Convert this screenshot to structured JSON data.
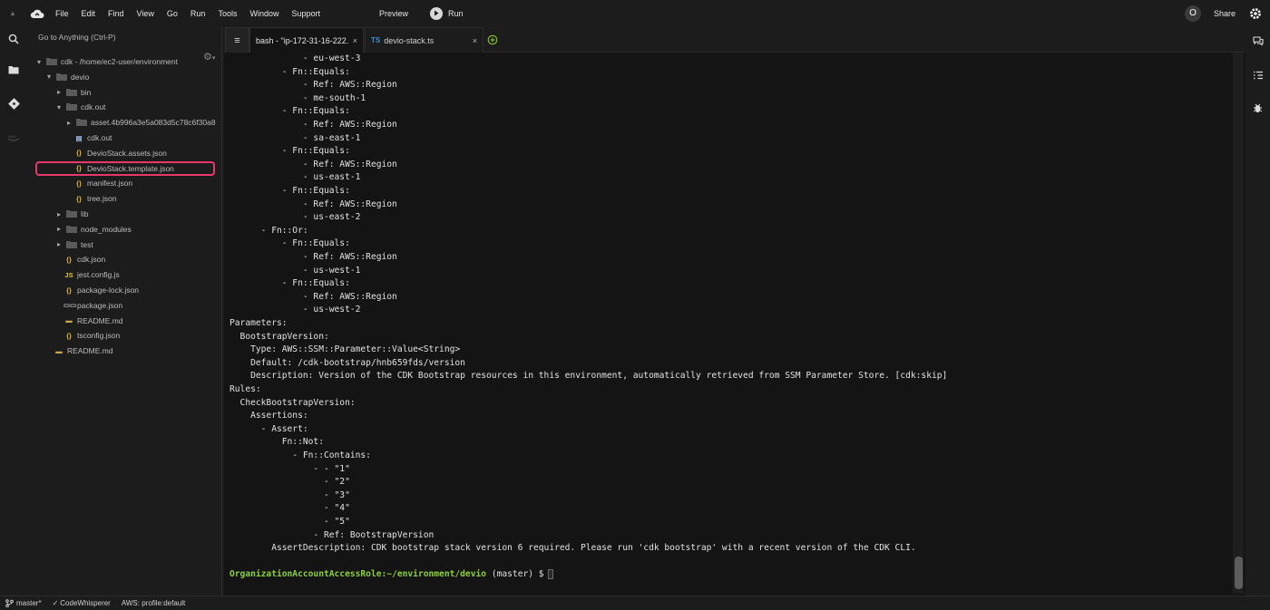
{
  "menubar": {
    "items": [
      "File",
      "Edit",
      "Find",
      "View",
      "Go",
      "Run",
      "Tools",
      "Window",
      "Support"
    ],
    "preview": "Preview",
    "run": "Run",
    "avatar_initial": "O",
    "share": "Share"
  },
  "sidebar": {
    "goto_placeholder": "Go to Anything (Ctrl-P)",
    "tree": [
      {
        "label": "cdk - /home/ec2-user/environment",
        "type": "folder",
        "expanded": true,
        "depth": 0
      },
      {
        "label": "devio",
        "type": "folder",
        "expanded": true,
        "depth": 1
      },
      {
        "label": "bin",
        "type": "folder",
        "expanded": false,
        "depth": 2
      },
      {
        "label": "cdk.out",
        "type": "folder",
        "expanded": true,
        "depth": 2
      },
      {
        "label": "asset.4b996a3e5a083d5c78c6f30a8",
        "type": "folder",
        "expanded": false,
        "depth": 3
      },
      {
        "label": "cdk.out",
        "type": "file-doc",
        "depth": 3
      },
      {
        "label": "DevioStack.assets.json",
        "type": "file-json",
        "depth": 3
      },
      {
        "label": "DevioStack.template.json",
        "type": "file-json",
        "depth": 3,
        "selected": true
      },
      {
        "label": "manifest.json",
        "type": "file-json",
        "depth": 3
      },
      {
        "label": "tree.json",
        "type": "file-json",
        "depth": 3
      },
      {
        "label": "lib",
        "type": "folder",
        "expanded": false,
        "depth": 2
      },
      {
        "label": "node_modules",
        "type": "folder",
        "expanded": false,
        "depth": 2
      },
      {
        "label": "test",
        "type": "folder",
        "expanded": false,
        "depth": 2
      },
      {
        "label": "cdk.json",
        "type": "file-json",
        "depth": 2
      },
      {
        "label": "jest.config.js",
        "type": "file-js",
        "depth": 2
      },
      {
        "label": "package-lock.json",
        "type": "file-json",
        "depth": 2
      },
      {
        "label": "package.json",
        "type": "file-npm",
        "depth": 2
      },
      {
        "label": "README.md",
        "type": "file-md",
        "depth": 2
      },
      {
        "label": "tsconfig.json",
        "type": "file-json",
        "depth": 2
      },
      {
        "label": "README.md",
        "type": "file-md",
        "depth": 1
      }
    ]
  },
  "tabs": [
    {
      "label": "bash - \"ip-172-31-16-222.",
      "close": "×",
      "active": true
    },
    {
      "label": "devio-stack.ts",
      "badge": "TS",
      "close": "×",
      "active": false
    }
  ],
  "terminal": {
    "lines": [
      "              - eu-west-3",
      "          - Fn::Equals:",
      "              - Ref: AWS::Region",
      "              - me-south-1",
      "          - Fn::Equals:",
      "              - Ref: AWS::Region",
      "              - sa-east-1",
      "          - Fn::Equals:",
      "              - Ref: AWS::Region",
      "              - us-east-1",
      "          - Fn::Equals:",
      "              - Ref: AWS::Region",
      "              - us-east-2",
      "      - Fn::Or:",
      "          - Fn::Equals:",
      "              - Ref: AWS::Region",
      "              - us-west-1",
      "          - Fn::Equals:",
      "              - Ref: AWS::Region",
      "              - us-west-2",
      "Parameters:",
      "  BootstrapVersion:",
      "    Type: AWS::SSM::Parameter::Value<String>",
      "    Default: /cdk-bootstrap/hnb659fds/version",
      "    Description: Version of the CDK Bootstrap resources in this environment, automatically retrieved from SSM Parameter Store. [cdk:skip]",
      "Rules:",
      "  CheckBootstrapVersion:",
      "    Assertions:",
      "      - Assert:",
      "          Fn::Not:",
      "            - Fn::Contains:",
      "                - - \"1\"",
      "                  - \"2\"",
      "                  - \"3\"",
      "                  - \"4\"",
      "                  - \"5\"",
      "                - Ref: BootstrapVersion",
      "        AssertDescription: CDK bootstrap stack version 6 required. Please run 'cdk bootstrap' with a recent version of the CDK CLI.",
      ""
    ],
    "prompt_user": "OrganizationAccountAccessRole",
    "prompt_path": ":~/environment/devio",
    "prompt_branch": " (master) $"
  },
  "statusbar": {
    "branch": "master*",
    "codewhisperer": "CodeWhisperer",
    "aws_profile": "AWS: profile:default"
  }
}
